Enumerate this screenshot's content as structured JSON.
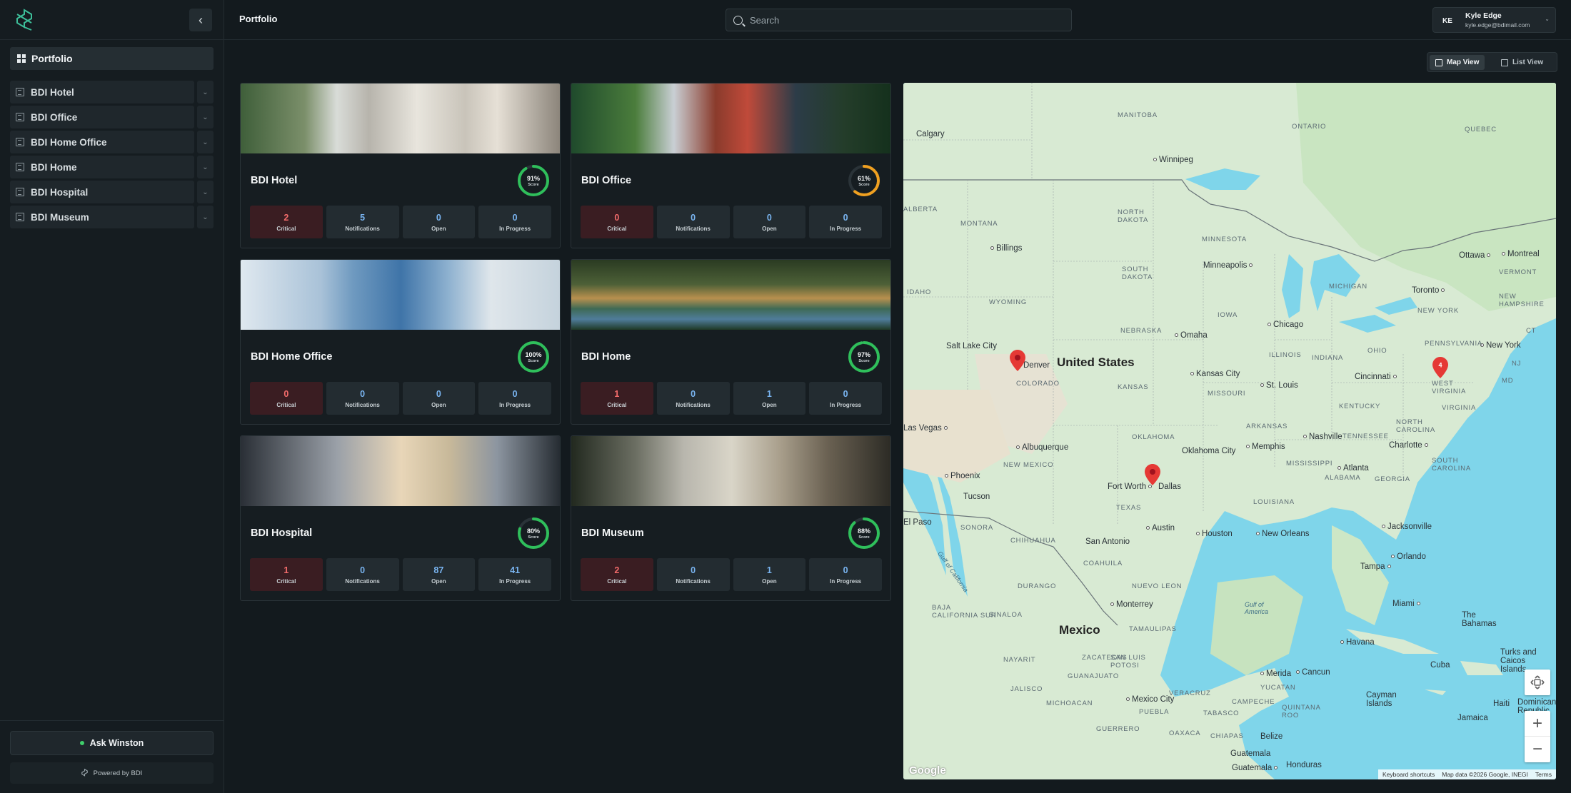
{
  "sidebar": {
    "portfolio_label": "Portfolio",
    "items": [
      {
        "label": "BDI Hotel"
      },
      {
        "label": "BDI Office"
      },
      {
        "label": "BDI Home Office"
      },
      {
        "label": "BDI Home"
      },
      {
        "label": "BDI Hospital"
      },
      {
        "label": "BDI Museum"
      }
    ],
    "ask_label": "Ask Winston",
    "powered_label": "Powered by BDI"
  },
  "header": {
    "title": "Portfolio",
    "search_placeholder": "Search",
    "user": {
      "initials": "KE",
      "name": "Kyle Edge",
      "email": "kyle.edge@bdimail.com"
    }
  },
  "view_toggle": {
    "map_label": "Map View",
    "list_label": "List View",
    "active": "map"
  },
  "stat_labels": {
    "critical": "Critical",
    "notifications": "Notifications",
    "open": "Open",
    "in_progress": "In Progress"
  },
  "score_label": "Score",
  "colors": {
    "score_green": "#2fbf5b",
    "score_orange": "#f0a020",
    "critical_red": "#f26b6b",
    "accent_blue": "#79b4f0"
  },
  "buildings": [
    {
      "name": "BDI Hotel",
      "score": "91%",
      "score_value": 91,
      "critical": "2",
      "notifications": "5",
      "open": "0",
      "in_progress": "0"
    },
    {
      "name": "BDI Office",
      "score": "61%",
      "score_value": 61,
      "critical": "0",
      "notifications": "0",
      "open": "0",
      "in_progress": "0"
    },
    {
      "name": "BDI Home Office",
      "score": "100%",
      "score_value": 100,
      "critical": "0",
      "notifications": "0",
      "open": "0",
      "in_progress": "0"
    },
    {
      "name": "BDI Home",
      "score": "97%",
      "score_value": 97,
      "critical": "1",
      "notifications": "0",
      "open": "1",
      "in_progress": "0"
    },
    {
      "name": "BDI Hospital",
      "score": "80%",
      "score_value": 80,
      "critical": "1",
      "notifications": "0",
      "open": "87",
      "in_progress": "41"
    },
    {
      "name": "BDI Museum",
      "score": "88%",
      "score_value": 88,
      "critical": "2",
      "notifications": "0",
      "open": "1",
      "in_progress": "0"
    }
  ],
  "map": {
    "countries": [
      "United States",
      "Mexico"
    ],
    "states": [
      "NORTH DAKOTA",
      "MINNESOTA",
      "MONTANA",
      "SOUTH DAKOTA",
      "WYOMING",
      "NEBRASKA",
      "IOWA",
      "COLORADO",
      "KANSAS",
      "ILLINOIS",
      "INDIANA",
      "OHIO",
      "MICHIGAN",
      "OKLAHOMA",
      "NEW MEXICO",
      "TEXAS",
      "TENNESSEE",
      "KENTUCKY",
      "WEST VIRGINIA",
      "VIRGINIA",
      "PENNSYLVANIA",
      "ONTARIO",
      "QUEBEC",
      "MANITOBA",
      "ALBERTA",
      "NEW YORK",
      "SONORA",
      "CHIHUAHUA",
      "COAHUILA",
      "DURANGO",
      "SINALOA",
      "NUEVO LEON",
      "MISSISSIPPI",
      "ALABAMA",
      "GEORGIA",
      "SOUTH CAROLINA",
      "NORTH CAROLINA",
      "VERMONT",
      "NEW HAMPSHIRE",
      "LOUISIANA",
      "ARKANSAS",
      "MISSOURI",
      "ZACATECAS",
      "SAN LUIS POTOSI",
      "NAYARIT",
      "JALISCO",
      "GUANAJUATO",
      "MICHOACAN",
      "GUERRERO",
      "OAXACA",
      "PUEBLA",
      "VERACRUZ",
      "TABASCO",
      "CAMPECHE",
      "YUCATAN",
      "QUINTANA ROO",
      "CHIAPAS",
      "BAJA CALIFORNIA SUR",
      "TAMAULIPAS",
      "CT",
      "NJ",
      "MD"
    ],
    "cities": [
      "Calgary",
      "Winnipeg",
      "Ottawa",
      "Montreal",
      "Toronto",
      "Minneapolis",
      "Chicago",
      "Billings",
      "Salt Lake City",
      "Denver",
      "Kansas City",
      "St. Louis",
      "Cincinnati",
      "Omaha",
      "New York",
      "Las Vegas",
      "Albuquerque",
      "Phoenix",
      "Tucson",
      "Fort Worth",
      "Dallas",
      "Austin",
      "San Antonio",
      "Houston",
      "Memphis",
      "Nashville",
      "Atlanta",
      "Charlotte",
      "Jacksonville",
      "Orlando",
      "Tampa",
      "Miami",
      "New Orleans",
      "Monterrey",
      "Mexico City",
      "Havana",
      "Merida",
      "Cancun",
      "Guatemala",
      "Belize",
      "Honduras",
      "Jamaica",
      "Haiti",
      "Dominican Republic",
      "The Bahamas",
      "Turks and Caicos Islands",
      "Cayman Islands",
      "Cuba",
      "El Paso",
      "Oklahoma City"
    ],
    "waters": [
      "Gulf of America",
      "Gulf of California"
    ],
    "google_label": "Google",
    "attribution": [
      "Keyboard shortcuts",
      "Map data ©2026 Google, INEGI",
      "Terms"
    ],
    "cluster_count": "4"
  }
}
